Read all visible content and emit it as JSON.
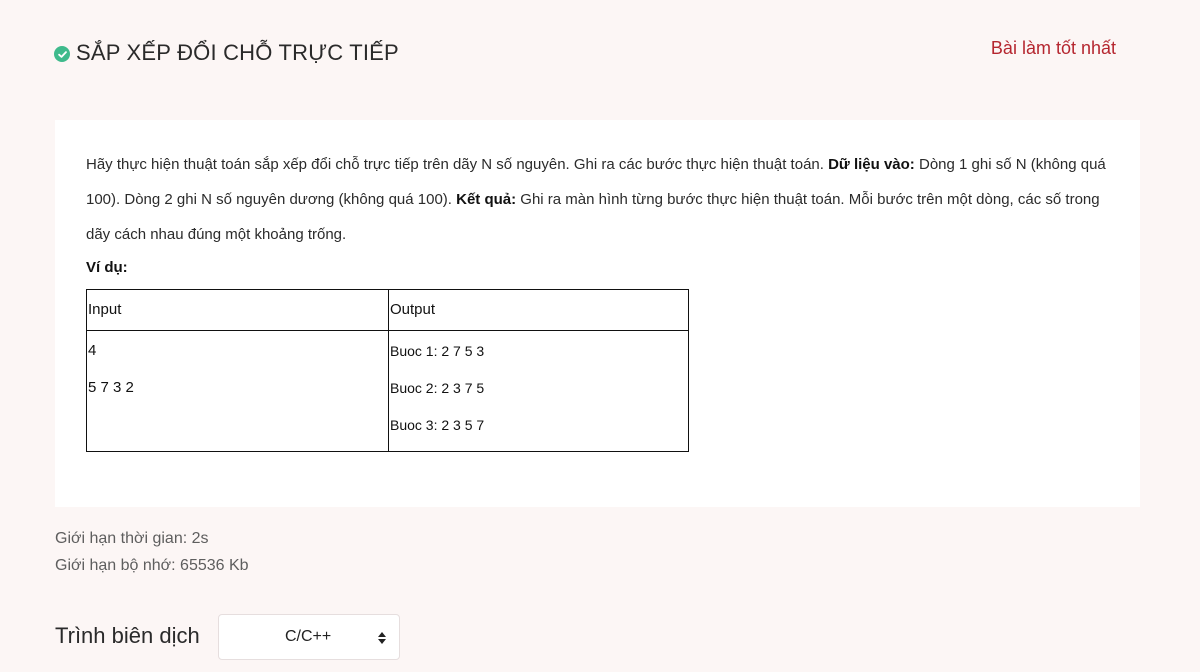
{
  "header": {
    "title": "SẮP XẾP ĐỔI CHỖ TRỰC TIẾP",
    "status_icon": "check-circle-icon",
    "status_color": "#3fba8c",
    "best_link": "Bài làm tốt nhất",
    "best_link_color": "#b5262f"
  },
  "problem": {
    "desc_part1": "Hãy thực hiện thuật toán sắp xếp đổi chỗ trực tiếp trên dãy N số nguyên. Ghi ra các bước thực hiện thuật toán. ",
    "input_label": "Dữ liệu vào:",
    "desc_part2": " Dòng 1 ghi số N (không quá 100). Dòng 2 ghi N số nguyên dương (không quá 100). ",
    "output_label": "Kết quả:",
    "desc_part3": " Ghi ra màn hình từng bước thực hiện thuật toán. Mỗi bước trên một dòng, các số trong dãy cách nhau đúng một khoảng trống.",
    "example_label": "Ví dụ:",
    "example": {
      "headers": [
        "Input",
        "Output"
      ],
      "input_lines": [
        "4",
        "5 7 3 2"
      ],
      "output_lines": [
        "Buoc 1: 2 7 5 3",
        "Buoc 2: 2 3 7 5",
        "Buoc 3: 2 3 5 7"
      ]
    }
  },
  "limits": {
    "time": "Giới hạn thời gian: 2s",
    "memory": "Giới hạn bộ nhớ: 65536 Kb"
  },
  "compiler": {
    "label": "Trình biên dịch",
    "selected": "C/C++",
    "icon": "updown-arrows-icon"
  }
}
